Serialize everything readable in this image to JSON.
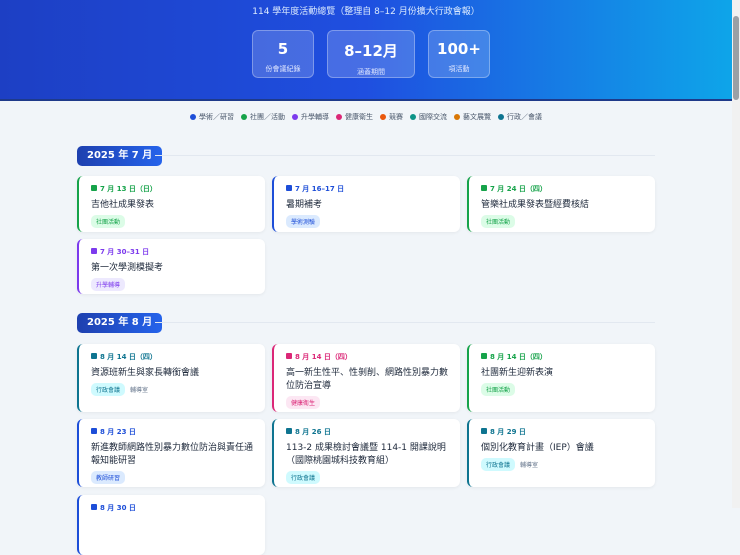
{
  "header": {
    "title": "114 學年度活動總覽（整理自 8–12 月份擴大行政會報）",
    "stats": [
      {
        "value": "5",
        "label": "份會議紀錄"
      },
      {
        "value": "8–12月",
        "label": "涵蓋期間"
      },
      {
        "value": "100+",
        "label": "項活動"
      }
    ]
  },
  "legend": [
    {
      "label": "學術／研習",
      "color": "#1d4ed8"
    },
    {
      "label": "社團／活動",
      "color": "#16a34a"
    },
    {
      "label": "升學輔導",
      "color": "#7c3aed"
    },
    {
      "label": "健康衛生",
      "color": "#db2777"
    },
    {
      "label": "競賽",
      "color": "#ea580c"
    },
    {
      "label": "國際交流",
      "color": "#0d9488"
    },
    {
      "label": "藝文展覽",
      "color": "#d97706"
    },
    {
      "label": "行政／會議",
      "color": "#0e7490"
    }
  ],
  "months": [
    {
      "label": "2025 年 7 月",
      "events": [
        {
          "date": "7 月 13 日（日）",
          "title": "吉他社成果發表",
          "tag": "社團活動",
          "color": "#16a34a",
          "bg": "#dcfce7"
        },
        {
          "date": "7 月 16–17 日",
          "title": "暑期補考",
          "tag": "學術測驗",
          "color": "#1d4ed8",
          "bg": "#dbeafe"
        },
        {
          "date": "7 月 24 日（四）",
          "title": "管樂社成果發表暨經費核結",
          "tag": "社團活動",
          "color": "#16a34a",
          "bg": "#dcfce7"
        },
        {
          "date": "7 月 30–31 日",
          "title": "第一次學測模擬考",
          "tag": "升學輔導",
          "color": "#7c3aed",
          "bg": "#ede9fe"
        }
      ]
    },
    {
      "label": "2025 年 8 月",
      "events": [
        {
          "date": "8 月 14 日（四）",
          "title": "資源班新生與家長轉銜會議",
          "tag": "行政會議",
          "sub": "輔導室",
          "color": "#0e7490",
          "bg": "#cffafe"
        },
        {
          "date": "8 月 14 日（四）",
          "title": "高一新生性平、性剝削、網路性別暴力數位防治宣導",
          "tag": "健康衛生",
          "color": "#db2777",
          "bg": "#fce7f3"
        },
        {
          "date": "8 月 14 日（四）",
          "title": "社團新生迎新表演",
          "tag": "社團活動",
          "color": "#16a34a",
          "bg": "#dcfce7"
        },
        {
          "date": "8 月 23 日",
          "title": "新進教師網路性別暴力數位防治與責任通報知能研習",
          "tag": "教師研習",
          "color": "#1d4ed8",
          "bg": "#dbeafe"
        },
        {
          "date": "8 月 26 日",
          "title": "113-2 成果檢討會議暨 114-1 開課說明（國際桃園城科技教育組）",
          "tag": "行政會議",
          "color": "#0e7490",
          "bg": "#cffafe"
        },
        {
          "date": "8 月 29 日",
          "title": "個別化教育計畫（IEP）會議",
          "tag": "行政會議",
          "sub": "輔導室",
          "color": "#0e7490",
          "bg": "#cffafe"
        },
        {
          "date": "8 月 30 日",
          "title": "",
          "tag": "",
          "color": "#1d4ed8",
          "bg": "#dbeafe"
        }
      ]
    }
  ]
}
